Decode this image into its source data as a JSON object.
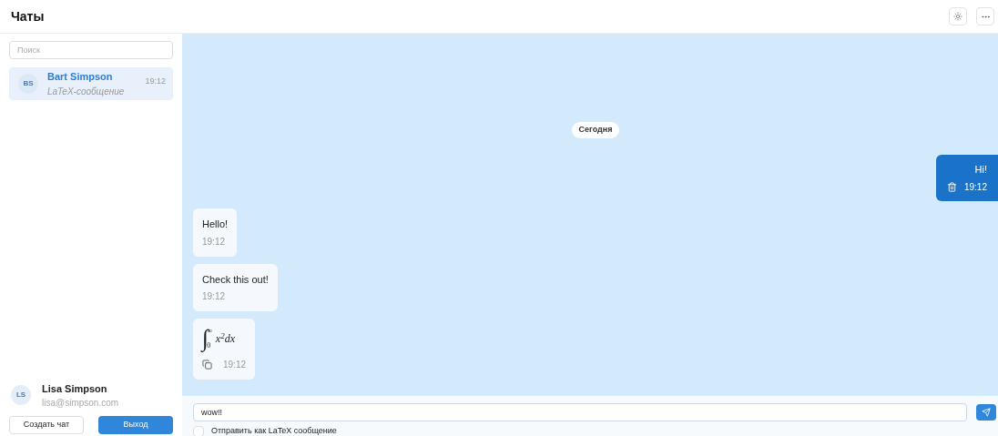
{
  "header": {
    "title": "Чаты"
  },
  "sidebar": {
    "search": {
      "placeholder": "Поиск"
    },
    "chats": [
      {
        "initials": "BS",
        "name": "Bart Simpson",
        "preview": "LaTeX-сообщение",
        "time": "19:12",
        "selected": true
      }
    ],
    "user": {
      "initials": "LS",
      "name": "Lisa Simpson",
      "email": "lisa@simpson.com"
    },
    "buttons": [
      {
        "label": "Создать чат",
        "kind": "secondary"
      },
      {
        "label": "Выход",
        "kind": "primary"
      }
    ]
  },
  "chat": {
    "date": "Сегодня",
    "messages": [
      {
        "kind": "outgoing",
        "text": "Hi!",
        "time": "19:12"
      },
      {
        "kind": "incoming",
        "text": "Hello!",
        "time": "19:12"
      },
      {
        "kind": "incoming",
        "text": "Check this out!",
        "time": "19:12"
      },
      {
        "kind": "latex",
        "symbol": "∫",
        "lower": "0",
        "upper": "∞",
        "body": "x$^{2}$dx",
        "time": "19:12"
      }
    ],
    "composer": {
      "value": "wow!!",
      "latex_label": "Отправить как LaTeX сообщение",
      "latex_checked": false
    }
  }
}
